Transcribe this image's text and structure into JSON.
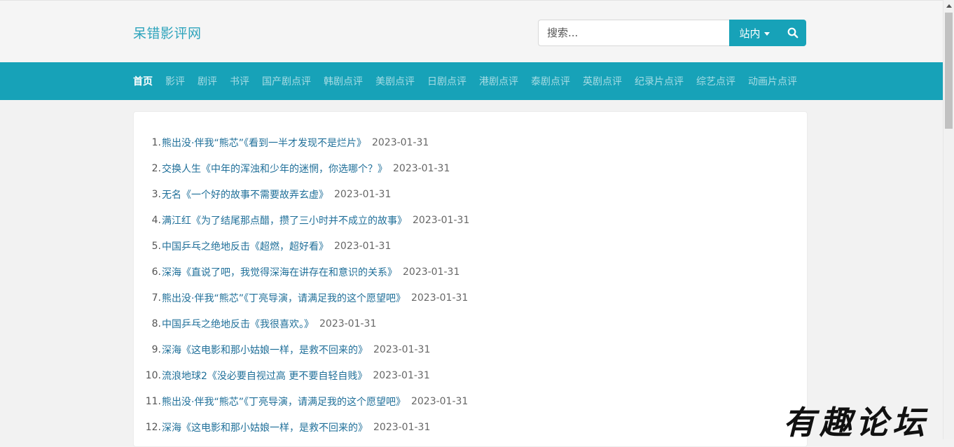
{
  "header": {
    "site_title": "呆错影评网",
    "search": {
      "placeholder": "搜索...",
      "value": ""
    },
    "scope_label": "站内",
    "search_icon": "search-icon"
  },
  "nav": {
    "items": [
      {
        "label": "首页",
        "active": true
      },
      {
        "label": "影评",
        "active": false
      },
      {
        "label": "剧评",
        "active": false
      },
      {
        "label": "书评",
        "active": false
      },
      {
        "label": "国产剧点评",
        "active": false
      },
      {
        "label": "韩剧点评",
        "active": false
      },
      {
        "label": "美剧点评",
        "active": false
      },
      {
        "label": "日剧点评",
        "active": false
      },
      {
        "label": "港剧点评",
        "active": false
      },
      {
        "label": "泰剧点评",
        "active": false
      },
      {
        "label": "英剧点评",
        "active": false
      },
      {
        "label": "纪录片点评",
        "active": false
      },
      {
        "label": "综艺点评",
        "active": false
      },
      {
        "label": "动画片点评",
        "active": false
      }
    ]
  },
  "reviews": [
    {
      "num": "1.",
      "title": "熊出没·伴我“熊芯”《看到一半才发现不是烂片》",
      "date": "2023-01-31"
    },
    {
      "num": "2.",
      "title": "交换人生《中年的浑浊和少年的迷惘，你选哪个？》",
      "date": "2023-01-31"
    },
    {
      "num": "3.",
      "title": "无名《一个好的故事不需要故弄玄虚》",
      "date": "2023-01-31"
    },
    {
      "num": "4.",
      "title": "满江红《为了结尾那点醋，攒了三小时并不成立的故事》",
      "date": "2023-01-31"
    },
    {
      "num": "5.",
      "title": "中国乒乓之绝地反击《超燃，超好看》",
      "date": "2023-01-31"
    },
    {
      "num": "6.",
      "title": "深海《直说了吧，我觉得深海在讲存在和意识的关系》",
      "date": "2023-01-31"
    },
    {
      "num": "7.",
      "title": "熊出没·伴我“熊芯”《丁亮导演，请满足我的这个愿望吧》",
      "date": "2023-01-31"
    },
    {
      "num": "8.",
      "title": "中国乒乓之绝地反击《我很喜欢。》",
      "date": "2023-01-31"
    },
    {
      "num": "9.",
      "title": "深海《这电影和那小姑娘一样，是救不回来的》",
      "date": "2023-01-31"
    },
    {
      "num": "10.",
      "title": "流浪地球2《没必要自视过高 更不要自轻自贱》",
      "date": "2023-01-31"
    },
    {
      "num": "11.",
      "title": "熊出没·伴我“熊芯”《丁亮导演，请满足我的这个愿望吧》",
      "date": "2023-01-31"
    },
    {
      "num": "12.",
      "title": "深海《这电影和那小姑娘一样，是救不回来的》",
      "date": "2023-01-31"
    }
  ],
  "watermark": "有趣论坛",
  "colors": {
    "accent": "#17a2b8",
    "link": "#1f6f99",
    "title": "#2ea4bc"
  }
}
